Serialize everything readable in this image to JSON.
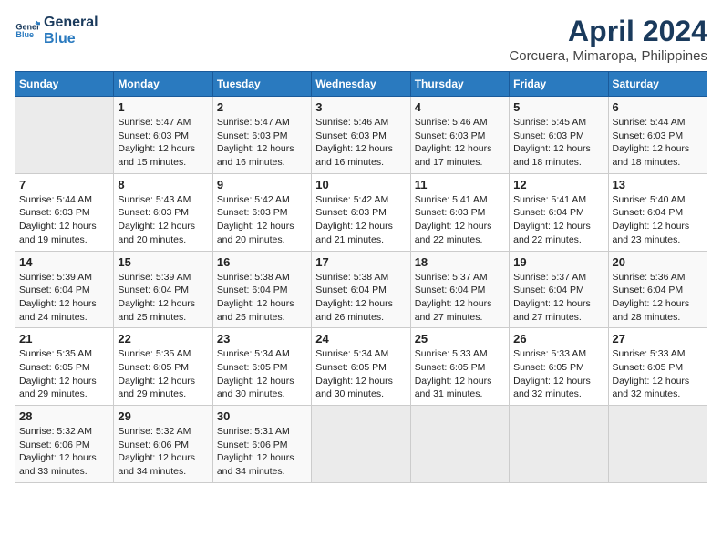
{
  "header": {
    "logo_line1": "General",
    "logo_line2": "Blue",
    "title": "April 2024",
    "subtitle": "Corcuera, Mimaropa, Philippines"
  },
  "days_of_week": [
    "Sunday",
    "Monday",
    "Tuesday",
    "Wednesday",
    "Thursday",
    "Friday",
    "Saturday"
  ],
  "weeks": [
    [
      {
        "day": "",
        "empty": true
      },
      {
        "day": "1",
        "sunrise": "5:47 AM",
        "sunset": "6:03 PM",
        "daylight": "12 hours and 15 minutes."
      },
      {
        "day": "2",
        "sunrise": "5:47 AM",
        "sunset": "6:03 PM",
        "daylight": "12 hours and 16 minutes."
      },
      {
        "day": "3",
        "sunrise": "5:46 AM",
        "sunset": "6:03 PM",
        "daylight": "12 hours and 16 minutes."
      },
      {
        "day": "4",
        "sunrise": "5:46 AM",
        "sunset": "6:03 PM",
        "daylight": "12 hours and 17 minutes."
      },
      {
        "day": "5",
        "sunrise": "5:45 AM",
        "sunset": "6:03 PM",
        "daylight": "12 hours and 18 minutes."
      },
      {
        "day": "6",
        "sunrise": "5:44 AM",
        "sunset": "6:03 PM",
        "daylight": "12 hours and 18 minutes."
      }
    ],
    [
      {
        "day": "7",
        "sunrise": "5:44 AM",
        "sunset": "6:03 PM",
        "daylight": "12 hours and 19 minutes."
      },
      {
        "day": "8",
        "sunrise": "5:43 AM",
        "sunset": "6:03 PM",
        "daylight": "12 hours and 20 minutes."
      },
      {
        "day": "9",
        "sunrise": "5:42 AM",
        "sunset": "6:03 PM",
        "daylight": "12 hours and 20 minutes."
      },
      {
        "day": "10",
        "sunrise": "5:42 AM",
        "sunset": "6:03 PM",
        "daylight": "12 hours and 21 minutes."
      },
      {
        "day": "11",
        "sunrise": "5:41 AM",
        "sunset": "6:03 PM",
        "daylight": "12 hours and 22 minutes."
      },
      {
        "day": "12",
        "sunrise": "5:41 AM",
        "sunset": "6:04 PM",
        "daylight": "12 hours and 22 minutes."
      },
      {
        "day": "13",
        "sunrise": "5:40 AM",
        "sunset": "6:04 PM",
        "daylight": "12 hours and 23 minutes."
      }
    ],
    [
      {
        "day": "14",
        "sunrise": "5:39 AM",
        "sunset": "6:04 PM",
        "daylight": "12 hours and 24 minutes."
      },
      {
        "day": "15",
        "sunrise": "5:39 AM",
        "sunset": "6:04 PM",
        "daylight": "12 hours and 25 minutes."
      },
      {
        "day": "16",
        "sunrise": "5:38 AM",
        "sunset": "6:04 PM",
        "daylight": "12 hours and 25 minutes."
      },
      {
        "day": "17",
        "sunrise": "5:38 AM",
        "sunset": "6:04 PM",
        "daylight": "12 hours and 26 minutes."
      },
      {
        "day": "18",
        "sunrise": "5:37 AM",
        "sunset": "6:04 PM",
        "daylight": "12 hours and 27 minutes."
      },
      {
        "day": "19",
        "sunrise": "5:37 AM",
        "sunset": "6:04 PM",
        "daylight": "12 hours and 27 minutes."
      },
      {
        "day": "20",
        "sunrise": "5:36 AM",
        "sunset": "6:04 PM",
        "daylight": "12 hours and 28 minutes."
      }
    ],
    [
      {
        "day": "21",
        "sunrise": "5:35 AM",
        "sunset": "6:05 PM",
        "daylight": "12 hours and 29 minutes."
      },
      {
        "day": "22",
        "sunrise": "5:35 AM",
        "sunset": "6:05 PM",
        "daylight": "12 hours and 29 minutes."
      },
      {
        "day": "23",
        "sunrise": "5:34 AM",
        "sunset": "6:05 PM",
        "daylight": "12 hours and 30 minutes."
      },
      {
        "day": "24",
        "sunrise": "5:34 AM",
        "sunset": "6:05 PM",
        "daylight": "12 hours and 30 minutes."
      },
      {
        "day": "25",
        "sunrise": "5:33 AM",
        "sunset": "6:05 PM",
        "daylight": "12 hours and 31 minutes."
      },
      {
        "day": "26",
        "sunrise": "5:33 AM",
        "sunset": "6:05 PM",
        "daylight": "12 hours and 32 minutes."
      },
      {
        "day": "27",
        "sunrise": "5:33 AM",
        "sunset": "6:05 PM",
        "daylight": "12 hours and 32 minutes."
      }
    ],
    [
      {
        "day": "28",
        "sunrise": "5:32 AM",
        "sunset": "6:06 PM",
        "daylight": "12 hours and 33 minutes."
      },
      {
        "day": "29",
        "sunrise": "5:32 AM",
        "sunset": "6:06 PM",
        "daylight": "12 hours and 34 minutes."
      },
      {
        "day": "30",
        "sunrise": "5:31 AM",
        "sunset": "6:06 PM",
        "daylight": "12 hours and 34 minutes."
      },
      {
        "day": "",
        "empty": true
      },
      {
        "day": "",
        "empty": true
      },
      {
        "day": "",
        "empty": true
      },
      {
        "day": "",
        "empty": true
      }
    ]
  ]
}
